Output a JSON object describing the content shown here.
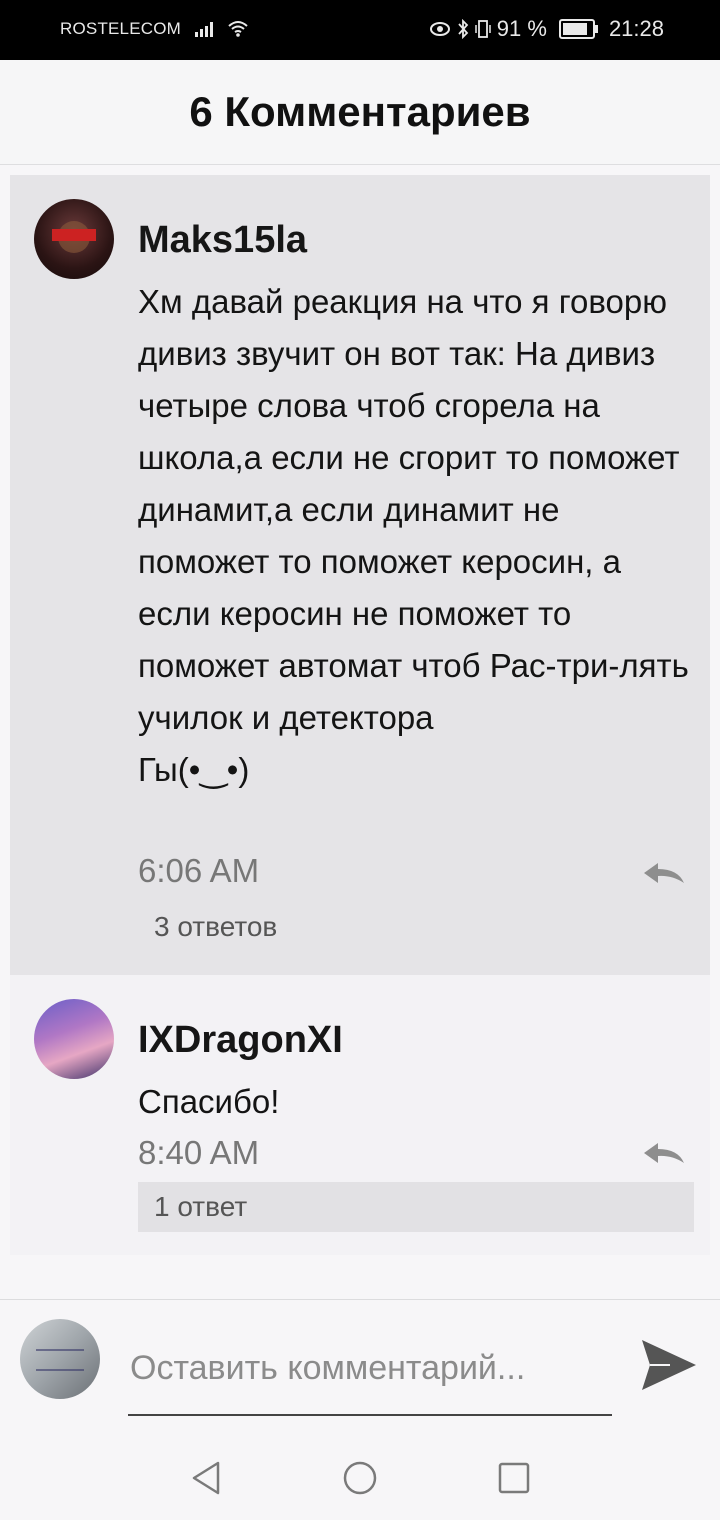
{
  "status_bar": {
    "carrier": "ROSTELECOM",
    "battery": "91 %",
    "time": "21:28"
  },
  "header": {
    "title": "6 Комментариев"
  },
  "comments": [
    {
      "author": "Maks15la",
      "text": "Хм давай реакция на что я говорю дивиз звучит он вот так: На дивиз четыре слова чтоб сгорела на школа,а если не сгорит то поможет динамит,а если динамит не поможет то поможет керосин, а если керосин не поможет то поможет автомат чтоб Рас-три-лять училок и детектора\nГы(•‿•)",
      "time": "6:06 AM",
      "replies": "3 ответов"
    },
    {
      "author": "IXDragonXI",
      "text": "Спасибо!",
      "time": "8:40 AM",
      "replies": "1 ответ"
    }
  ],
  "composer": {
    "placeholder": "Оставить комментарий..."
  },
  "icons": {
    "reply": "reply-icon",
    "send": "send-icon",
    "back": "back-icon",
    "home": "home-icon",
    "recent": "recent-apps-icon"
  }
}
